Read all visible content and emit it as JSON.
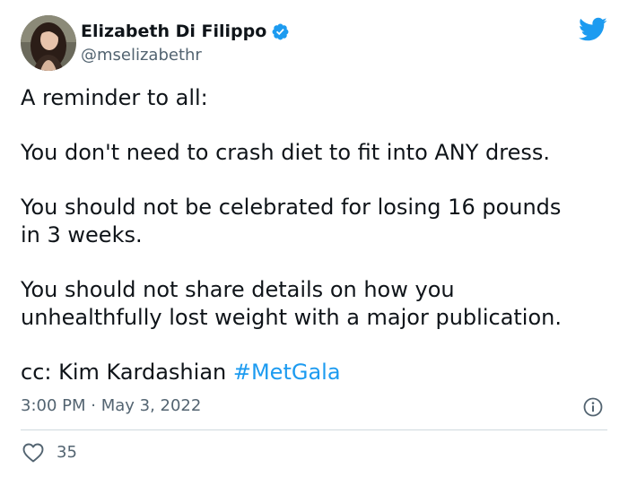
{
  "author": {
    "display_name": "Elizabeth Di Filippo",
    "handle": "@mselizabethr",
    "verified": true,
    "avatar_icon": "profile-photo"
  },
  "brand": {
    "logo_icon": "twitter-bird-icon",
    "color": "#1d9bf0"
  },
  "tweet": {
    "line1": "A reminder to all:",
    "line2": "You don't need to crash diet to fit into ANY dress.",
    "line3a": "You should not be celebrated for losing 16 pounds",
    "line3b": "in 3 weeks.",
    "line4a": "You should not share details on how you",
    "line4b": "unhealthfully lost weight with a major publication.",
    "line5_prefix": "cc: Kim Kardashian ",
    "hashtag": "#MetGala",
    "timestamp": "3:00 PM · May 3, 2022"
  },
  "actions": {
    "like_icon": "heart-icon",
    "like_count": "35",
    "info_icon": "info-icon"
  },
  "colors": {
    "text": "#0f1419",
    "secondary": "#536471",
    "link": "#1d9bf0",
    "divider": "#cfd9de"
  }
}
